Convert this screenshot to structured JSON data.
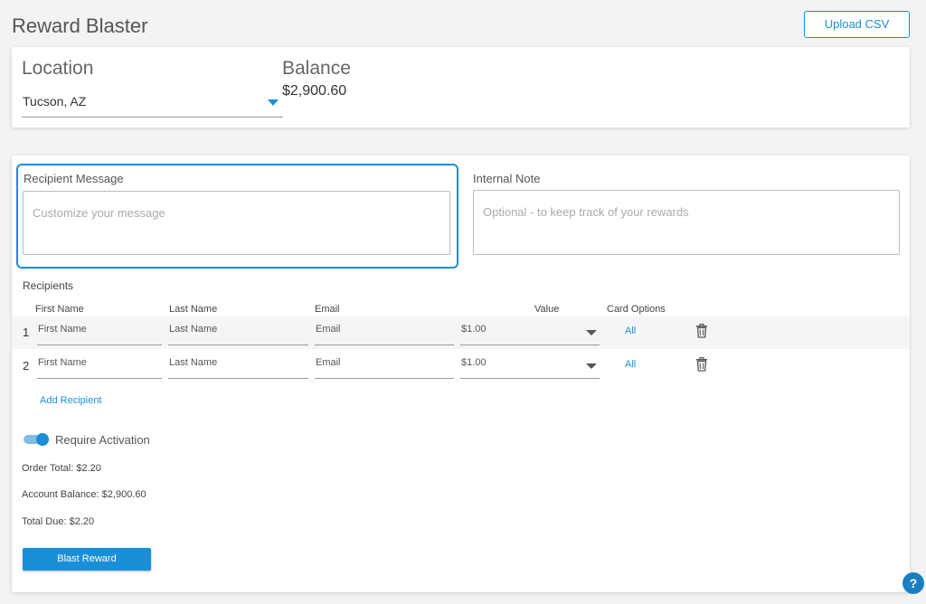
{
  "header": {
    "title": "Reward Blaster",
    "upload_label": "Upload CSV"
  },
  "location": {
    "label": "Location",
    "value": "Tucson, AZ",
    "caret_icon": "chevron-down-icon"
  },
  "balance": {
    "label": "Balance",
    "value": "$2,900.60"
  },
  "message": {
    "label": "Recipient Message",
    "placeholder": "Customize your message"
  },
  "note": {
    "label": "Internal Note",
    "placeholder": "Optional - to keep track of your rewards"
  },
  "recipients": {
    "label": "Recipients",
    "columns": [
      "First Name",
      "Last Name",
      "Email",
      "Value",
      "Card Options"
    ],
    "rows": [
      {
        "num": "1",
        "first": "First Name",
        "last": "Last Name",
        "email": "Email",
        "value": "$1.00",
        "options": "All"
      },
      {
        "num": "2",
        "first": "First Name",
        "last": "Last Name",
        "email": "Email",
        "value": "$1.00",
        "options": "All"
      }
    ],
    "add_label": "Add Recipient"
  },
  "activation": {
    "label": "Require Activation",
    "enabled": true
  },
  "summary": {
    "order_total": "Order Total: $2.20",
    "account_balance": "Account Balance: $2,900.60",
    "total_due": "Total Due: $2.20"
  },
  "blast_label": "Blast Reward",
  "help_label": "?",
  "colors": {
    "accent": "#1a8fd8",
    "background": "#f3f3f5"
  }
}
